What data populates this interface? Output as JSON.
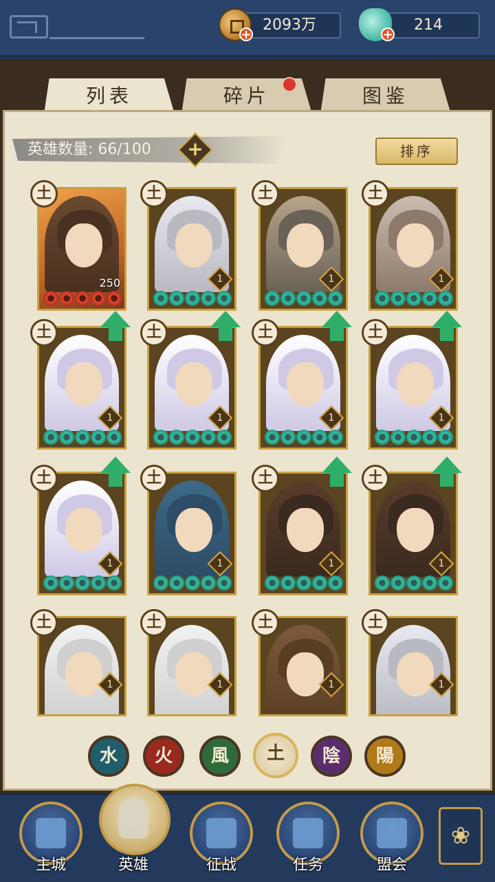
{
  "currency": {
    "coins": "2093万",
    "jade": "214"
  },
  "tabs": [
    {
      "label": "列表",
      "active": true
    },
    {
      "label": "碎片",
      "active": false,
      "notify": true
    },
    {
      "label": "图鉴",
      "active": false
    }
  ],
  "hero_count_label": "英雄数量: 66/100",
  "sort_label": "排序",
  "heroes": [
    {
      "name_icon": "hero-orange-robe-portrait",
      "element": "土",
      "stars": 5,
      "star_color": "red",
      "level": "250",
      "frame": "gold"
    },
    {
      "name_icon": "hero-silver-hair-scholar-portrait",
      "element": "土",
      "stars": 5,
      "star_color": "green",
      "level": "1"
    },
    {
      "name_icon": "hero-horned-crown-lady-portrait",
      "element": "土",
      "stars": 5,
      "star_color": "green",
      "level": "1"
    },
    {
      "name_icon": "hero-pale-hair-maiden-portrait",
      "element": "土",
      "stars": 5,
      "star_color": "green",
      "level": "1"
    },
    {
      "name_icon": "hero-white-hair-warrior-portrait",
      "element": "土",
      "stars": 5,
      "star_color": "green",
      "level": "1",
      "upgradable": true
    },
    {
      "name_icon": "hero-white-hair-warrior-portrait",
      "element": "土",
      "stars": 5,
      "star_color": "green",
      "level": "1",
      "upgradable": true
    },
    {
      "name_icon": "hero-white-hair-warrior-portrait",
      "element": "土",
      "stars": 5,
      "star_color": "green",
      "level": "1",
      "upgradable": true
    },
    {
      "name_icon": "hero-white-hair-warrior-portrait",
      "element": "土",
      "stars": 5,
      "star_color": "green",
      "level": "1",
      "upgradable": true
    },
    {
      "name_icon": "hero-white-hair-warrior-portrait",
      "element": "土",
      "stars": 5,
      "star_color": "green",
      "level": "1",
      "upgradable": true
    },
    {
      "name_icon": "hero-blue-hair-bandana-portrait",
      "element": "土",
      "stars": 5,
      "star_color": "green",
      "level": "1"
    },
    {
      "name_icon": "hero-bearded-general-portrait",
      "element": "土",
      "stars": 5,
      "star_color": "green",
      "level": "1",
      "upgradable": true
    },
    {
      "name_icon": "hero-bearded-general-portrait",
      "element": "土",
      "stars": 5,
      "star_color": "green",
      "level": "1",
      "upgradable": true
    },
    {
      "name_icon": "hero-old-monk-portrait",
      "element": "土",
      "level": "1"
    },
    {
      "name_icon": "hero-old-monk-portrait",
      "element": "土",
      "level": "1"
    },
    {
      "name_icon": "hero-long-hair-swordsman-portrait",
      "element": "土",
      "level": "1"
    },
    {
      "name_icon": "hero-silver-hair-scholar-portrait",
      "element": "土",
      "level": "1"
    }
  ],
  "element_filters": [
    {
      "label": "水",
      "color": "#1f5f6c"
    },
    {
      "label": "火",
      "color": "#9a2a1e"
    },
    {
      "label": "風",
      "color": "#2f6a3a"
    },
    {
      "label": "土",
      "color": "#d8c49a",
      "active": true
    },
    {
      "label": "陰",
      "color": "#5a2e6e"
    },
    {
      "label": "陽",
      "color": "#b07a18"
    }
  ],
  "nav": [
    {
      "label": "主城",
      "icon": "palace-icon"
    },
    {
      "label": "英雄",
      "icon": "hero-avatar-icon",
      "active": true
    },
    {
      "label": "征战",
      "icon": "vase-icon"
    },
    {
      "label": "任务",
      "icon": "scroll-icon"
    },
    {
      "label": "盟会",
      "icon": "pavilion-icon"
    }
  ],
  "colors": {
    "accent_gold": "#c9a040",
    "panel_bg": "#ebe5cf",
    "nav_bg": "#233a5c",
    "star_green": "#38c4a8",
    "star_red": "#e84c36",
    "upgrade_green": "#2fae6a"
  }
}
